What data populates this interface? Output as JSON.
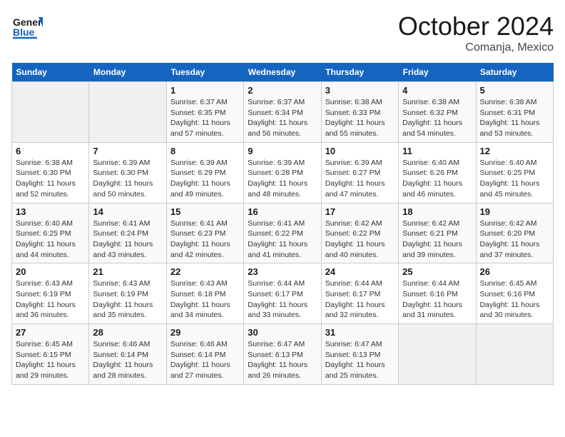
{
  "logo": {
    "general": "General",
    "blue": "Blue"
  },
  "title": "October 2024",
  "subtitle": "Comanja, Mexico",
  "weekdays": [
    "Sunday",
    "Monday",
    "Tuesday",
    "Wednesday",
    "Thursday",
    "Friday",
    "Saturday"
  ],
  "weeks": [
    [
      {
        "day": "",
        "sunrise": "",
        "sunset": "",
        "daylight": "",
        "empty": true
      },
      {
        "day": "",
        "sunrise": "",
        "sunset": "",
        "daylight": "",
        "empty": true
      },
      {
        "day": "1",
        "sunrise": "Sunrise: 6:37 AM",
        "sunset": "Sunset: 6:35 PM",
        "daylight": "Daylight: 11 hours and 57 minutes."
      },
      {
        "day": "2",
        "sunrise": "Sunrise: 6:37 AM",
        "sunset": "Sunset: 6:34 PM",
        "daylight": "Daylight: 11 hours and 56 minutes."
      },
      {
        "day": "3",
        "sunrise": "Sunrise: 6:38 AM",
        "sunset": "Sunset: 6:33 PM",
        "daylight": "Daylight: 11 hours and 55 minutes."
      },
      {
        "day": "4",
        "sunrise": "Sunrise: 6:38 AM",
        "sunset": "Sunset: 6:32 PM",
        "daylight": "Daylight: 11 hours and 54 minutes."
      },
      {
        "day": "5",
        "sunrise": "Sunrise: 6:38 AM",
        "sunset": "Sunset: 6:31 PM",
        "daylight": "Daylight: 11 hours and 53 minutes."
      }
    ],
    [
      {
        "day": "6",
        "sunrise": "Sunrise: 6:38 AM",
        "sunset": "Sunset: 6:30 PM",
        "daylight": "Daylight: 11 hours and 52 minutes."
      },
      {
        "day": "7",
        "sunrise": "Sunrise: 6:39 AM",
        "sunset": "Sunset: 6:30 PM",
        "daylight": "Daylight: 11 hours and 50 minutes."
      },
      {
        "day": "8",
        "sunrise": "Sunrise: 6:39 AM",
        "sunset": "Sunset: 6:29 PM",
        "daylight": "Daylight: 11 hours and 49 minutes."
      },
      {
        "day": "9",
        "sunrise": "Sunrise: 6:39 AM",
        "sunset": "Sunset: 6:28 PM",
        "daylight": "Daylight: 11 hours and 48 minutes."
      },
      {
        "day": "10",
        "sunrise": "Sunrise: 6:39 AM",
        "sunset": "Sunset: 6:27 PM",
        "daylight": "Daylight: 11 hours and 47 minutes."
      },
      {
        "day": "11",
        "sunrise": "Sunrise: 6:40 AM",
        "sunset": "Sunset: 6:26 PM",
        "daylight": "Daylight: 11 hours and 46 minutes."
      },
      {
        "day": "12",
        "sunrise": "Sunrise: 6:40 AM",
        "sunset": "Sunset: 6:25 PM",
        "daylight": "Daylight: 11 hours and 45 minutes."
      }
    ],
    [
      {
        "day": "13",
        "sunrise": "Sunrise: 6:40 AM",
        "sunset": "Sunset: 6:25 PM",
        "daylight": "Daylight: 11 hours and 44 minutes."
      },
      {
        "day": "14",
        "sunrise": "Sunrise: 6:41 AM",
        "sunset": "Sunset: 6:24 PM",
        "daylight": "Daylight: 11 hours and 43 minutes."
      },
      {
        "day": "15",
        "sunrise": "Sunrise: 6:41 AM",
        "sunset": "Sunset: 6:23 PM",
        "daylight": "Daylight: 11 hours and 42 minutes."
      },
      {
        "day": "16",
        "sunrise": "Sunrise: 6:41 AM",
        "sunset": "Sunset: 6:22 PM",
        "daylight": "Daylight: 11 hours and 41 minutes."
      },
      {
        "day": "17",
        "sunrise": "Sunrise: 6:42 AM",
        "sunset": "Sunset: 6:22 PM",
        "daylight": "Daylight: 11 hours and 40 minutes."
      },
      {
        "day": "18",
        "sunrise": "Sunrise: 6:42 AM",
        "sunset": "Sunset: 6:21 PM",
        "daylight": "Daylight: 11 hours and 39 minutes."
      },
      {
        "day": "19",
        "sunrise": "Sunrise: 6:42 AM",
        "sunset": "Sunset: 6:20 PM",
        "daylight": "Daylight: 11 hours and 37 minutes."
      }
    ],
    [
      {
        "day": "20",
        "sunrise": "Sunrise: 6:43 AM",
        "sunset": "Sunset: 6:19 PM",
        "daylight": "Daylight: 11 hours and 36 minutes."
      },
      {
        "day": "21",
        "sunrise": "Sunrise: 6:43 AM",
        "sunset": "Sunset: 6:19 PM",
        "daylight": "Daylight: 11 hours and 35 minutes."
      },
      {
        "day": "22",
        "sunrise": "Sunrise: 6:43 AM",
        "sunset": "Sunset: 6:18 PM",
        "daylight": "Daylight: 11 hours and 34 minutes."
      },
      {
        "day": "23",
        "sunrise": "Sunrise: 6:44 AM",
        "sunset": "Sunset: 6:17 PM",
        "daylight": "Daylight: 11 hours and 33 minutes."
      },
      {
        "day": "24",
        "sunrise": "Sunrise: 6:44 AM",
        "sunset": "Sunset: 6:17 PM",
        "daylight": "Daylight: 11 hours and 32 minutes."
      },
      {
        "day": "25",
        "sunrise": "Sunrise: 6:44 AM",
        "sunset": "Sunset: 6:16 PM",
        "daylight": "Daylight: 11 hours and 31 minutes."
      },
      {
        "day": "26",
        "sunrise": "Sunrise: 6:45 AM",
        "sunset": "Sunset: 6:16 PM",
        "daylight": "Daylight: 11 hours and 30 minutes."
      }
    ],
    [
      {
        "day": "27",
        "sunrise": "Sunrise: 6:45 AM",
        "sunset": "Sunset: 6:15 PM",
        "daylight": "Daylight: 11 hours and 29 minutes."
      },
      {
        "day": "28",
        "sunrise": "Sunrise: 6:46 AM",
        "sunset": "Sunset: 6:14 PM",
        "daylight": "Daylight: 11 hours and 28 minutes."
      },
      {
        "day": "29",
        "sunrise": "Sunrise: 6:46 AM",
        "sunset": "Sunset: 6:14 PM",
        "daylight": "Daylight: 11 hours and 27 minutes."
      },
      {
        "day": "30",
        "sunrise": "Sunrise: 6:47 AM",
        "sunset": "Sunset: 6:13 PM",
        "daylight": "Daylight: 11 hours and 26 minutes."
      },
      {
        "day": "31",
        "sunrise": "Sunrise: 6:47 AM",
        "sunset": "Sunset: 6:13 PM",
        "daylight": "Daylight: 11 hours and 25 minutes."
      },
      {
        "day": "",
        "sunrise": "",
        "sunset": "",
        "daylight": "",
        "empty": true
      },
      {
        "day": "",
        "sunrise": "",
        "sunset": "",
        "daylight": "",
        "empty": true
      }
    ]
  ]
}
